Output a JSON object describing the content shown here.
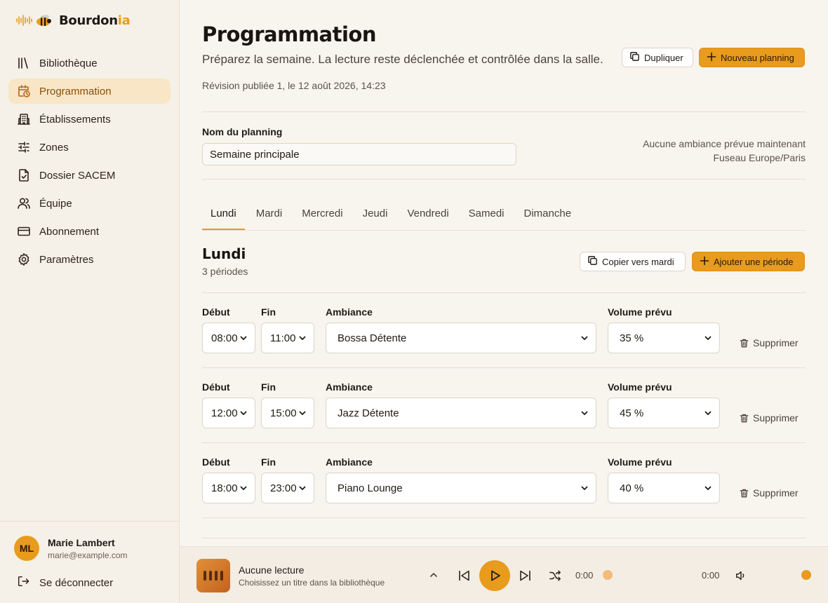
{
  "brand": {
    "name_main": "Bourdon",
    "name_accent": "ia"
  },
  "sidebar": {
    "items": [
      {
        "label": "Bibliothèque",
        "icon": "library-icon",
        "active": false
      },
      {
        "label": "Programmation",
        "icon": "calendar-clock-icon",
        "active": true
      },
      {
        "label": "Établissements",
        "icon": "building-icon",
        "active": false
      },
      {
        "label": "Zones",
        "icon": "sliders-icon",
        "active": false
      },
      {
        "label": "Dossier SACEM",
        "icon": "file-check-icon",
        "active": false
      },
      {
        "label": "Équipe",
        "icon": "users-icon",
        "active": false
      },
      {
        "label": "Abonnement",
        "icon": "credit-card-icon",
        "active": false
      },
      {
        "label": "Paramètres",
        "icon": "gear-icon",
        "active": false
      }
    ]
  },
  "user": {
    "initials": "ML",
    "name": "Marie Lambert",
    "email": "marie@example.com",
    "logout_label": "Se déconnecter"
  },
  "header": {
    "title": "Programmation",
    "subtitle": "Préparez la semaine. La lecture reste déclenchée et contrôlée dans la salle.",
    "revision": "Révision publiée 1, le 12 août 2026, 14:23",
    "duplicate_label": "Dupliquer",
    "new_label": "Nouveau planning"
  },
  "planning": {
    "name_label": "Nom du planning",
    "name_value": "Semaine principale",
    "status": "Aucune ambiance prévue maintenant",
    "timezone": "Fuseau Europe/Paris"
  },
  "tabs": [
    "Lundi",
    "Mardi",
    "Mercredi",
    "Jeudi",
    "Vendredi",
    "Samedi",
    "Dimanche"
  ],
  "active_tab": "Lundi",
  "day": {
    "title": "Lundi",
    "count": "3 périodes",
    "copy_label": "Copier vers mardi",
    "add_label": "Ajouter une période",
    "labels": {
      "start": "Début",
      "end": "Fin",
      "ambiance": "Ambiance",
      "volume": "Volume prévu",
      "delete": "Supprimer"
    },
    "periods": [
      {
        "start": "08:00",
        "end": "11:00",
        "ambiance": "Bossa Détente",
        "volume": "35 %"
      },
      {
        "start": "12:00",
        "end": "15:00",
        "ambiance": "Jazz Détente",
        "volume": "45 %"
      },
      {
        "start": "18:00",
        "end": "23:00",
        "ambiance": "Piano Lounge",
        "volume": "40 %"
      }
    ]
  },
  "player": {
    "title": "Aucune lecture",
    "subtitle": "Choisissez un titre dans la bibliothèque",
    "time_current": "0:00",
    "time_total": "0:00",
    "progress": 0,
    "volume": 1
  },
  "colors": {
    "accent": "#e89b1c",
    "active_bg": "#f8e6c6",
    "active_text": "#8a4f0c"
  }
}
